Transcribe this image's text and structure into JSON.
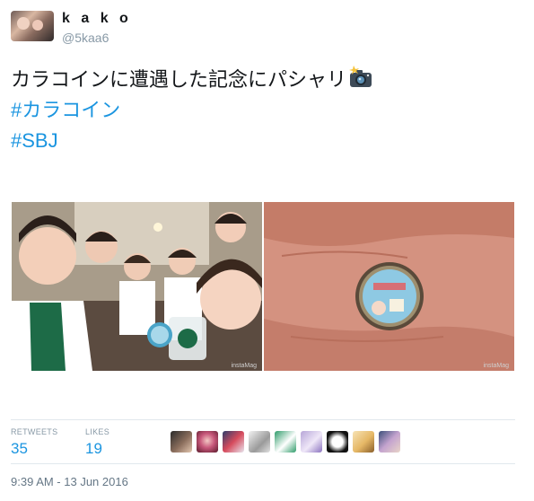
{
  "user": {
    "name": "k a k o",
    "handle": "@5kaa6"
  },
  "tweet": {
    "text": "カラコインに遭遇した記念にパシャリ",
    "hashtags": [
      "#カラコイン",
      "#SBJ"
    ]
  },
  "media": {
    "watermark": "instaMag"
  },
  "stats": {
    "retweets_label": "RETWEETS",
    "retweets": "35",
    "likes_label": "LIKES",
    "likes": "19",
    "liker_icons": [
      "liker-avatar-icon",
      "liker-avatar-icon",
      "liker-avatar-icon",
      "liker-avatar-icon",
      "liker-avatar-icon",
      "liker-avatar-icon",
      "liker-avatar-icon",
      "liker-avatar-icon",
      "liker-avatar-icon"
    ]
  },
  "timestamp": "9:39 AM - 13 Jun 2016",
  "colors": {
    "link": "#1b95e0",
    "muted": "#8899a6",
    "border": "#e1e8ed"
  }
}
